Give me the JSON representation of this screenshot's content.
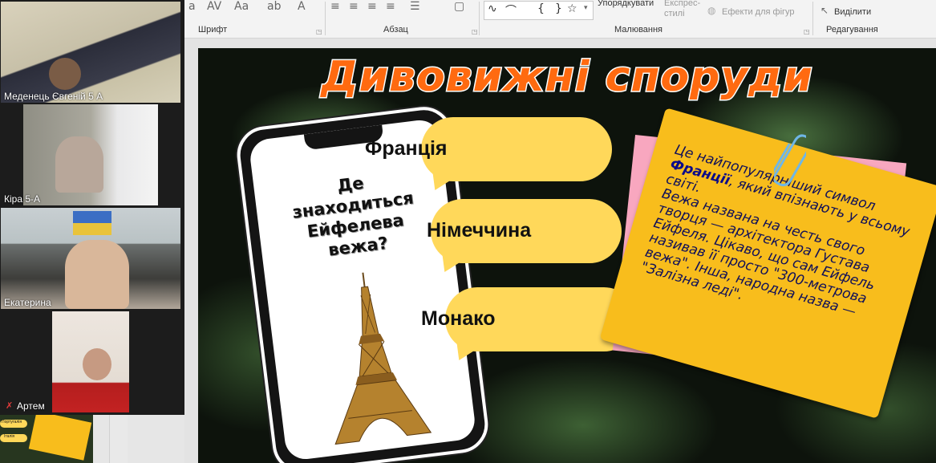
{
  "ribbon": {
    "groups": [
      {
        "label": "Шрифт"
      },
      {
        "label": "Абзац"
      },
      {
        "label": "Малювання"
      },
      {
        "label": "Редагування"
      }
    ],
    "arrange_label": "Упорядкувати",
    "quick_styles_label": "Експрес-стилі",
    "shape_effects_label": "Ефекти для фігур",
    "select_label": "Виділити"
  },
  "participants": [
    {
      "name": "Меденець Євгеній 5 А"
    },
    {
      "name": "Кіра 5-А"
    },
    {
      "name": "Екатерина"
    },
    {
      "name": "Артем"
    }
  ],
  "slide": {
    "title": "Дивовижні споруди",
    "question": "Де знаходиться Ейфелева вежа?",
    "options": [
      "Франція",
      "Німеччина",
      "Монако"
    ],
    "note_bold": "Франції",
    "note_line1": "Це найпопулярніший символ ",
    "note_line2": ", який впізнають у всьому світі.",
    "note_line3": "Вежа названа на честь свого творця — архітектора Густава Ейфеля. Цікаво, що сам Ейфель називав її просто \"300-метрова вежа\". Інша, народна назва — \"Залізна леді\".",
    "colors": {
      "title": "#ff6a10",
      "bubble": "#ffd85a",
      "note": "#f8bd1c",
      "note_pink": "#f8a7bf"
    }
  },
  "thumbnail": {
    "label1": "Португалія",
    "label2": "Італія"
  }
}
